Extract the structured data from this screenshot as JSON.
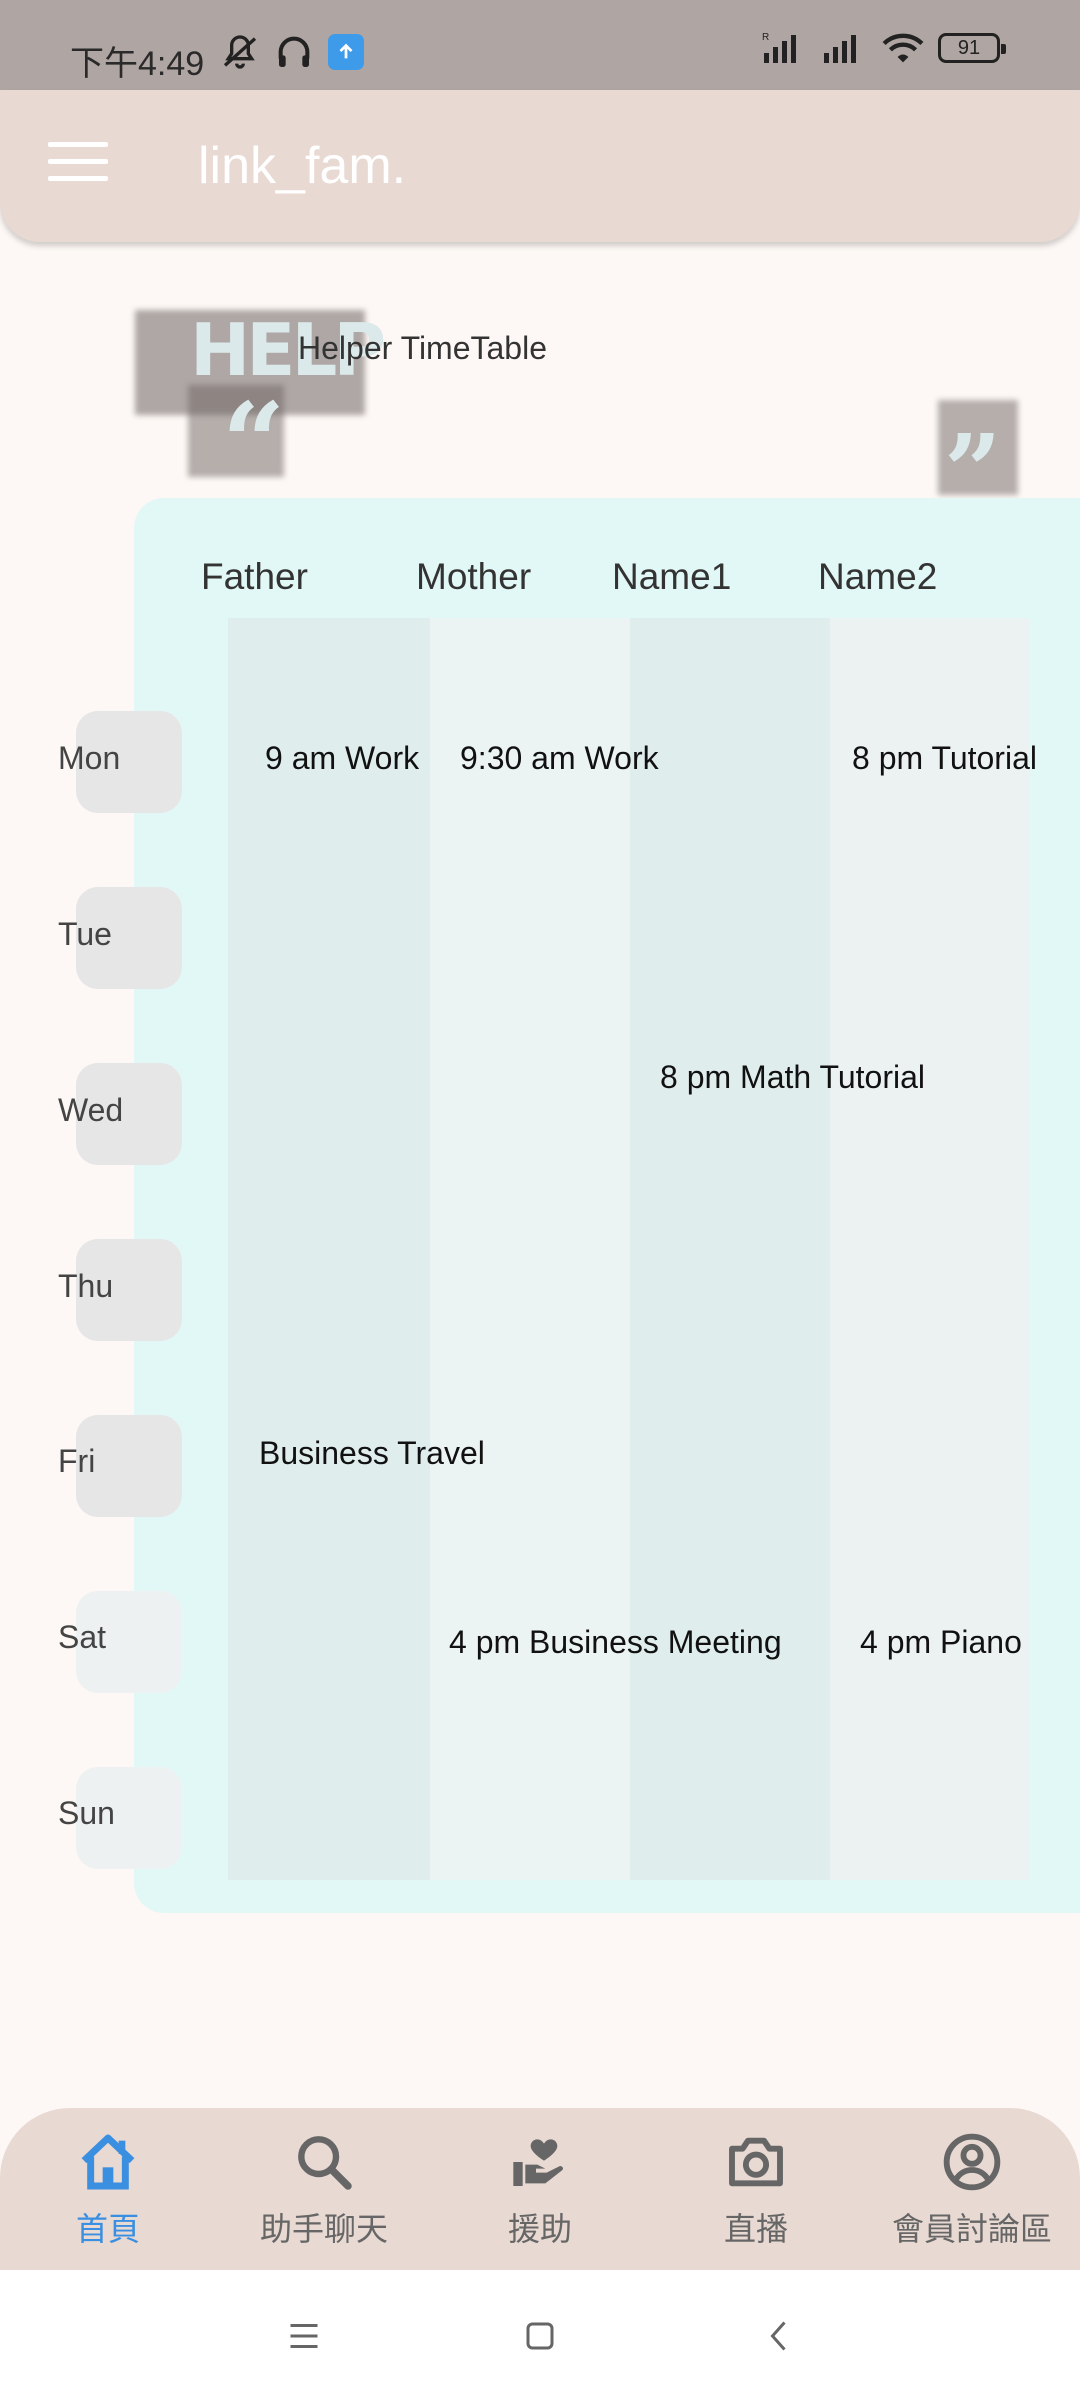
{
  "status_bar": {
    "time": "下午4:49",
    "battery": "91",
    "icons": [
      "mute-bell-icon",
      "headphones-icon",
      "upload-app-icon",
      "signal-icon",
      "signal-icon",
      "wifi-icon",
      "battery-icon"
    ]
  },
  "app_bar": {
    "title": "link_fam.",
    "menu_icon": "hamburger-menu-icon"
  },
  "section": {
    "logo_text": "HELP",
    "title": "Helper TimeTable"
  },
  "timetable": {
    "columns": [
      "Father",
      "Mother",
      "Name1",
      "Name2"
    ],
    "days": [
      "Mon",
      "Tue",
      "Wed",
      "Thu",
      "Fri",
      "Sat",
      "Sun"
    ],
    "events": {
      "mon_father": "9 am Work",
      "mon_mother": "9:30 am Work",
      "mon_name2": "8 pm Tutorial",
      "wed_name1": "8 pm Math Tutorial",
      "fri_father": "Business Travel",
      "sat_mother": "4 pm Business Meeting",
      "sat_name2": "4 pm Piano"
    }
  },
  "bottom_nav": {
    "items": [
      {
        "label": "首頁",
        "icon": "home-icon",
        "active": true
      },
      {
        "label": "助手聊天",
        "icon": "search-icon",
        "active": false
      },
      {
        "label": "援助",
        "icon": "helping-hand-icon",
        "active": false
      },
      {
        "label": "直播",
        "icon": "camera-icon",
        "active": false
      },
      {
        "label": "會員討論區",
        "icon": "account-circle-icon",
        "active": false
      }
    ]
  },
  "colors": {
    "app_bar": "#e8d9d3",
    "background": "#fdf8f5",
    "table_bg": "#e2f8f6",
    "accent": "#3b8fe0"
  }
}
